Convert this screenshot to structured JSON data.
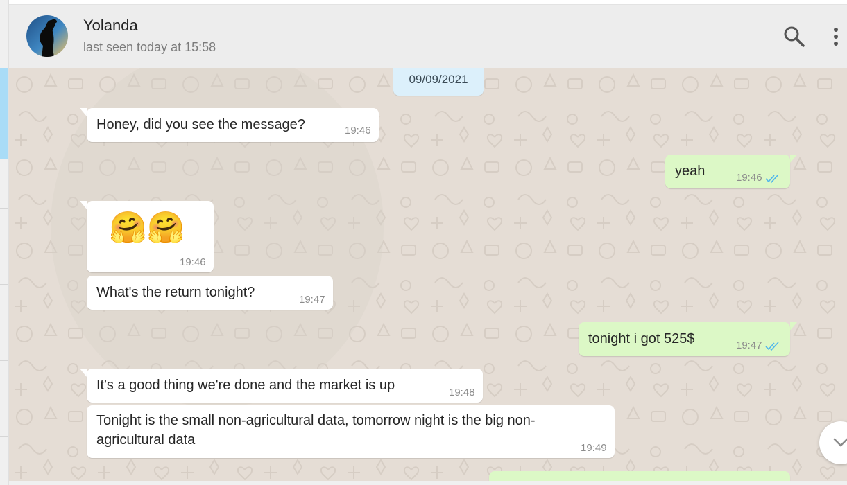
{
  "header": {
    "contact_name": "Yolanda",
    "last_seen": "last seen today at 15:58",
    "search_icon": "search-icon",
    "menu_icon": "vertical-dots-icon"
  },
  "chat": {
    "date_divider": "09/09/2021",
    "messages": [
      {
        "direction": "incoming",
        "text": "Honey, did you see the message?",
        "time": "19:46"
      },
      {
        "direction": "outgoing",
        "text": "yeah",
        "time": "19:46",
        "status": "read-double-check"
      },
      {
        "direction": "incoming",
        "text": "🤗🤗",
        "time": "19:46"
      },
      {
        "direction": "incoming",
        "text": "What's the return tonight?",
        "time": "19:47"
      },
      {
        "direction": "outgoing",
        "text": "tonight i got 525$",
        "time": "19:47",
        "status": "read-double-check"
      },
      {
        "direction": "incoming",
        "text": "It's a good thing we're done and the market is up",
        "time": "19:48"
      },
      {
        "direction": "incoming",
        "text_line1": "Tonight is the small non-agricultural data, tomorrow night is the big non-",
        "text_line2": "agricultural data",
        "time": "19:49"
      }
    ],
    "scroll_icon": "chevron-down-icon"
  },
  "colors": {
    "header_bg": "#ededed",
    "chat_bg": "#e5ddd5",
    "incoming_bubble": "#ffffff",
    "outgoing_bubble": "#dcf8c6",
    "read_ticks": "#4fb6ec",
    "date_chip": "#dcf0fb"
  }
}
